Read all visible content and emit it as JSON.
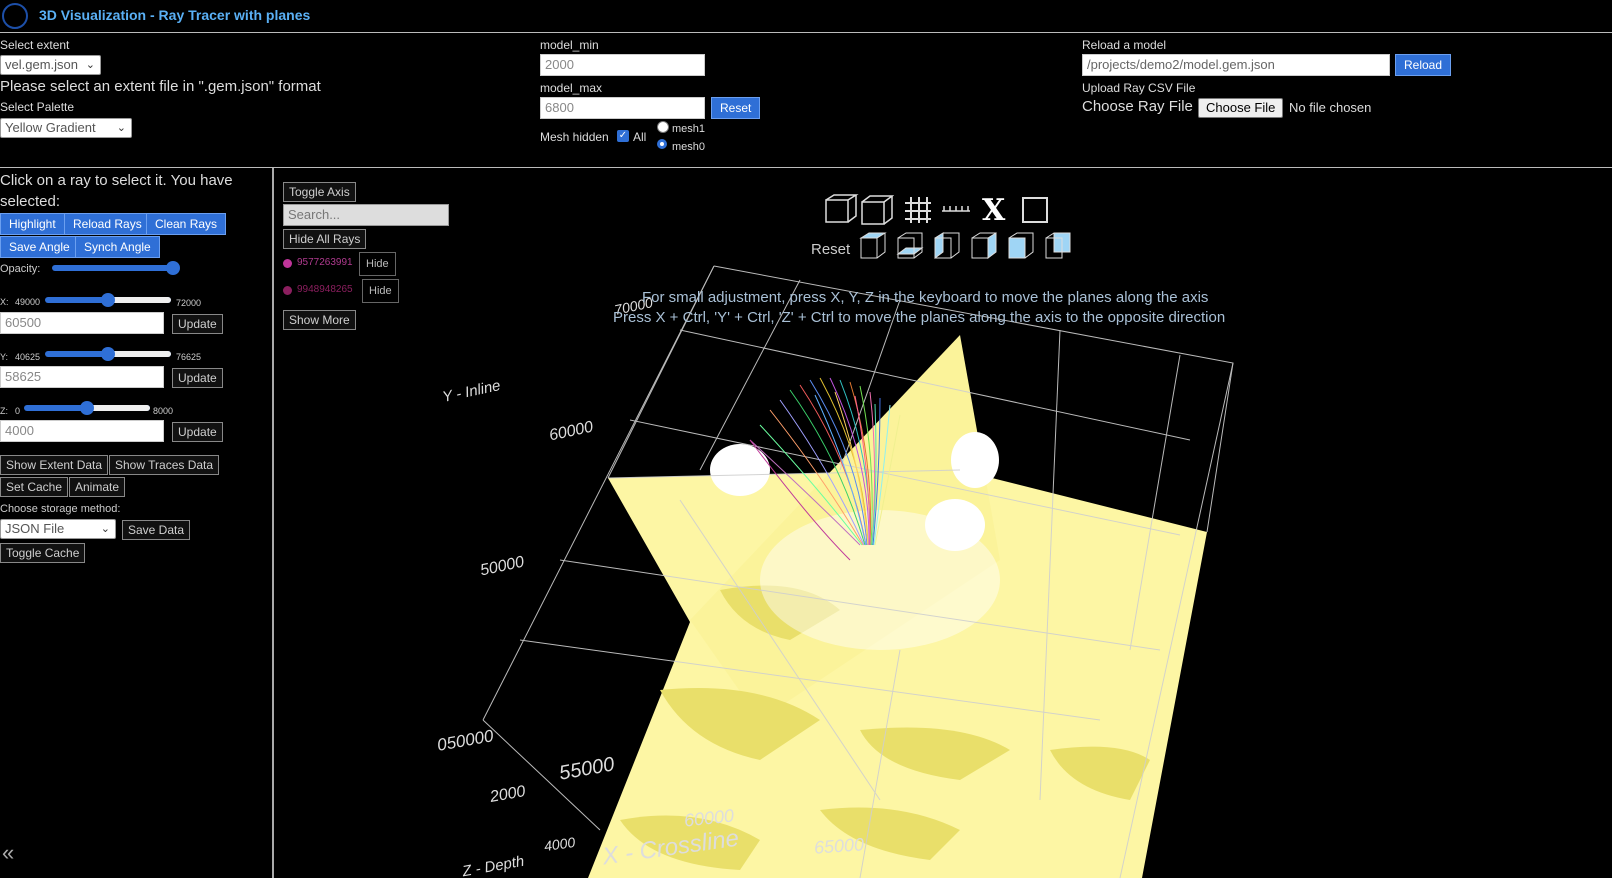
{
  "header": {
    "title": "3D Visualization - Ray Tracer with planes"
  },
  "top": {
    "select_extent_label": "Select extent",
    "select_extent_value": "vel.gem.json",
    "extent_hint": "Please select an extent file in \".gem.json\" format",
    "select_palette_label": "Select Palette",
    "select_palette_value": "Yellow Gradient",
    "model_min_label": "model_min",
    "model_min_value": "2000",
    "model_max_label": "model_max",
    "model_max_value": "6800",
    "reset_label": "Reset",
    "mesh_hidden_label": "Mesh hidden",
    "all_label": "All",
    "mesh1_label": "mesh1",
    "mesh0_label": "mesh0",
    "reload_model_label": "Reload a model",
    "model_path": "/projects/demo2/model.gem.json",
    "reload_button": "Reload",
    "upload_csv_label": "Upload Ray CSV File",
    "choose_ray_label": "Choose Ray File",
    "choose_file_button": "Choose File",
    "no_file": "No file chosen"
  },
  "sidebar": {
    "instruction": "Click on a ray to select it. You have selected:",
    "highlight": "Highlight",
    "reload_rays": "Reload Rays",
    "clean_rays": "Clean Rays",
    "save_angle": "Save Angle",
    "synch_angle": "Synch Angle",
    "opacity_label": "Opacity:",
    "opacity_value": 1.0,
    "x": {
      "label": "X:",
      "min": "49000",
      "max": "72000",
      "value": "60500",
      "fraction": 0.5
    },
    "y": {
      "label": "Y:",
      "min": "40625",
      "max": "76625",
      "value": "58625",
      "fraction": 0.5
    },
    "z": {
      "label": "Z:",
      "min": "0",
      "max": "8000",
      "value": "4000",
      "fraction": 0.5
    },
    "update": "Update",
    "show_extent": "Show Extent Data",
    "show_traces": "Show Traces Data",
    "set_cache": "Set Cache",
    "animate": "Animate",
    "storage_label": "Choose storage method:",
    "storage_value": "JSON File",
    "save_data": "Save Data",
    "toggle_cache": "Toggle Cache"
  },
  "rays_panel": {
    "toggle_axis": "Toggle Axis",
    "search_placeholder": "Search...",
    "hide_all": "Hide All Rays",
    "rays": [
      {
        "id": "9577263991",
        "color": "#c0359a",
        "action": "Hide"
      },
      {
        "id": "9948948265",
        "color": "#8c1f5f",
        "action": "Hide"
      }
    ],
    "show_more": "Show More"
  },
  "viewer": {
    "reset_label": "Reset",
    "hint1": "For small adjustment, press X, Y, Z in the keyboard to move the planes along the axis",
    "hint2": "Press X + Ctrl, 'Y' + Ctrl, 'Z' + Ctrl to move the planes along the axis to the opposite direction",
    "axis_y_title": "Y - Inline",
    "axis_x_title": "X - Crossline",
    "axis_z_title": "Z - Depth",
    "y_ticks": [
      "70000",
      "60000",
      "50000",
      "050000"
    ],
    "x_ticks": [
      "55000",
      "60000",
      "65000"
    ],
    "z_ticks": [
      "2000",
      "4000"
    ],
    "plane_color": "#fdf6a4",
    "plane_shade_color": "#e9df6a"
  }
}
